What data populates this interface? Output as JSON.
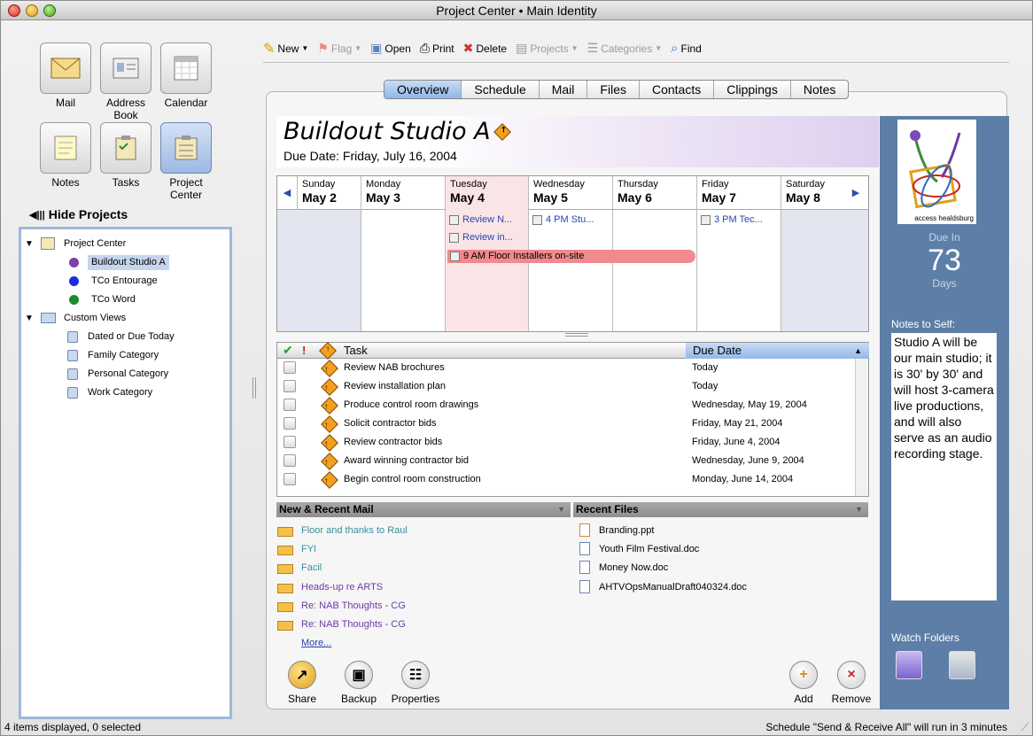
{
  "window": {
    "title": "Project Center • Main Identity"
  },
  "modules": [
    {
      "id": "mail",
      "label": "Mail",
      "icon": "mail-icon"
    },
    {
      "id": "address",
      "label": "Address Book",
      "icon": "address-book-icon"
    },
    {
      "id": "calendar",
      "label": "Calendar",
      "icon": "calendar-icon"
    },
    {
      "id": "notes",
      "label": "Notes",
      "icon": "notes-icon"
    },
    {
      "id": "tasks",
      "label": "Tasks",
      "icon": "tasks-icon"
    },
    {
      "id": "project",
      "label": "Project Center",
      "icon": "project-center-icon",
      "active": true
    }
  ],
  "sidebar": {
    "hide_label": "Hide Projects",
    "tree": [
      {
        "label": "Project Center",
        "icon": "project-center-icon"
      },
      {
        "label": "Buildout Studio A",
        "color": "#7b3fa8",
        "selected": true
      },
      {
        "label": "TCo Entourage",
        "color": "#1b2de0"
      },
      {
        "label": "TCo Word",
        "color": "#1a8c2a"
      },
      {
        "label": "Custom Views",
        "icon": "custom-views-icon"
      },
      {
        "label": "Dated or Due Today",
        "icon": "search-view-icon"
      },
      {
        "label": "Family Category",
        "icon": "search-view-icon"
      },
      {
        "label": "Personal Category",
        "icon": "search-view-icon"
      },
      {
        "label": "Work Category",
        "icon": "search-view-icon"
      }
    ]
  },
  "toolbar": {
    "new": "New",
    "flag": "Flag",
    "open": "Open",
    "print": "Print",
    "delete": "Delete",
    "projects": "Projects",
    "categories": "Categories",
    "find": "Find"
  },
  "tabs": [
    "Overview",
    "Schedule",
    "Mail",
    "Files",
    "Contacts",
    "Clippings",
    "Notes"
  ],
  "project": {
    "title": "Buildout Studio A",
    "due_date": "Due Date: Friday, July 16, 2004"
  },
  "calendar": {
    "days": [
      {
        "dow": "Sunday",
        "date": "May 2"
      },
      {
        "dow": "Monday",
        "date": "May 3"
      },
      {
        "dow": "Tuesday",
        "date": "May 4",
        "today": true
      },
      {
        "dow": "Wednesday",
        "date": "May 5"
      },
      {
        "dow": "Thursday",
        "date": "May 6"
      },
      {
        "dow": "Friday",
        "date": "May 7"
      },
      {
        "dow": "Saturday",
        "date": "May 8"
      }
    ],
    "events": [
      {
        "day": 2,
        "row": 0,
        "text": "Review N..."
      },
      {
        "day": 2,
        "row": 1,
        "text": "Review in..."
      },
      {
        "day": 3,
        "row": 0,
        "text": "4 PM Stu..."
      },
      {
        "day": 5,
        "row": 0,
        "text": "3 PM Tec..."
      }
    ],
    "long_event": "9 AM Floor Installers on-site"
  },
  "tasks": {
    "col_task": "Task",
    "col_due": "Due Date",
    "rows": [
      {
        "task": "Review NAB brochures",
        "due": "Today"
      },
      {
        "task": "Review installation plan",
        "due": "Today"
      },
      {
        "task": "Produce control room drawings",
        "due": "Wednesday, May 19, 2004"
      },
      {
        "task": "Solicit contractor bids",
        "due": "Friday, May 21, 2004"
      },
      {
        "task": "Review contractor bids",
        "due": "Friday, June 4, 2004"
      },
      {
        "task": "Award winning contractor bid",
        "due": "Wednesday, June 9, 2004"
      },
      {
        "task": "Begin control room construction",
        "due": "Monday, June 14, 2004"
      }
    ]
  },
  "mail": {
    "header": "New & Recent Mail",
    "items": [
      {
        "subject": "Floor and thanks to Raul",
        "color": "teal"
      },
      {
        "subject": "FYI",
        "color": "teal"
      },
      {
        "subject": "Facil",
        "color": "teal"
      },
      {
        "subject": "Heads-up re ARTS",
        "color": "purple"
      },
      {
        "subject": "Re: NAB Thoughts - CG",
        "color": "purple"
      },
      {
        "subject": "Re: NAB Thoughts - CG",
        "color": "purple"
      }
    ],
    "more": "More..."
  },
  "files": {
    "header": "Recent Files",
    "items": [
      "Branding.ppt",
      "Youth Film Festival.doc",
      "Money Now.doc",
      "AHTVOpsManualDraft040324.doc"
    ]
  },
  "bottom": {
    "share": "Share",
    "backup": "Backup",
    "properties": "Properties",
    "add": "Add",
    "remove": "Remove"
  },
  "right_panel": {
    "logo_text": "access healdsburg",
    "due_in_label": "Due In",
    "due_in_value": "73",
    "days_label": "Days",
    "notes_label": "Notes to Self:",
    "notes": "Studio A will be our main studio; it is 30' by 30' and will host 3-camera live productions, and will also serve as an audio recording stage.",
    "watch_label": "Watch Folders"
  },
  "status": {
    "left": "4 items displayed, 0 selected",
    "right": "Schedule \"Send & Receive All\" will run in 3 minutes"
  }
}
